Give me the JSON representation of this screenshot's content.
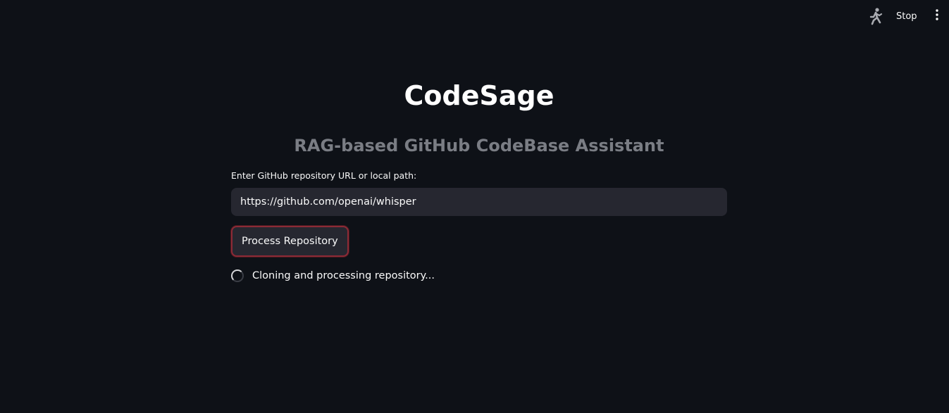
{
  "toolbar": {
    "running_icon": "running-man-icon",
    "stop_label": "Stop",
    "menu_icon": "vertical-ellipsis-icon"
  },
  "main": {
    "title": "CodeSage",
    "subtitle": "RAG-based GitHub CodeBase Assistant",
    "input_label": "Enter GitHub repository URL or local path:",
    "input_value": "https://github.com/openai/whisper",
    "process_button_label": "Process Repository",
    "status_text": "Cloning and processing repository..."
  },
  "colors": {
    "background": "#0e1117",
    "input_background": "#262730",
    "button_border_focus": "#8b2a36",
    "subtitle": "#7a7d84"
  }
}
